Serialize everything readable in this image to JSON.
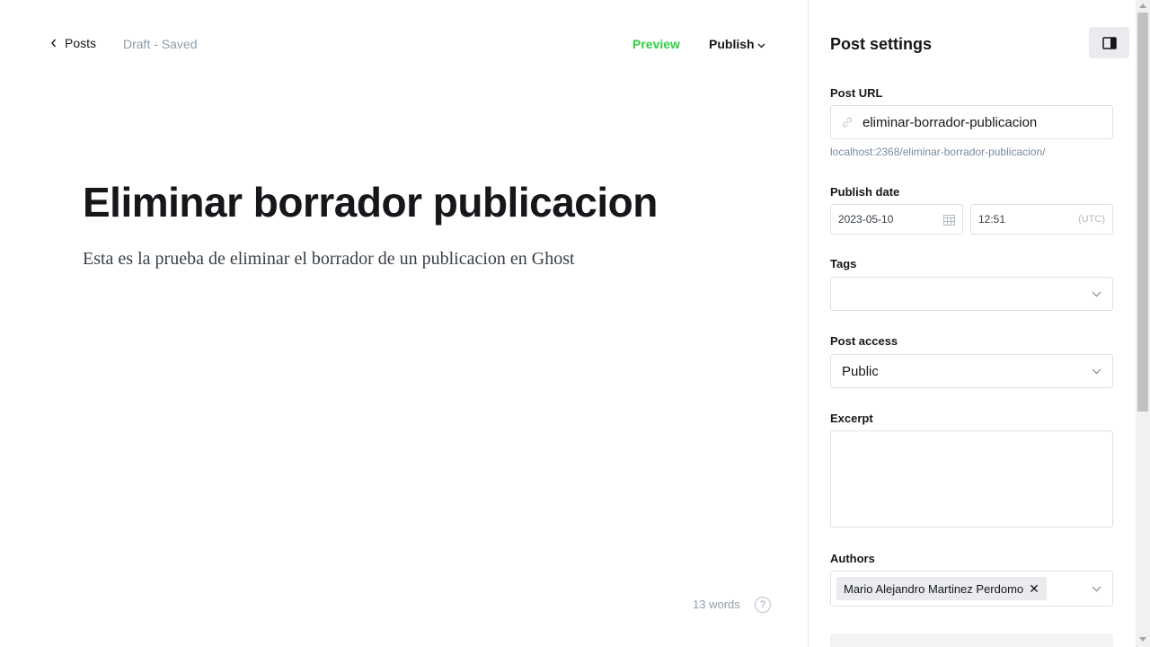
{
  "header": {
    "back_label": "Posts",
    "status": "Draft - Saved",
    "preview_label": "Preview",
    "publish_label": "Publish"
  },
  "post": {
    "title": "Eliminar borrador publicacion",
    "body": "Esta es la prueba de eliminar el borrador de un publicacion en Ghost",
    "word_count": "13 words"
  },
  "settings": {
    "title": "Post settings",
    "url_label": "Post URL",
    "url_value": "eliminar-borrador-publicacion",
    "url_hint": "localhost:2368/eliminar-borrador-publicacion/",
    "publish_date_label": "Publish date",
    "date_value": "2023-05-10",
    "time_value": "12:51",
    "timezone": "(UTC)",
    "tags_label": "Tags",
    "access_label": "Post access",
    "access_value": "Public",
    "excerpt_label": "Excerpt",
    "authors_label": "Authors",
    "author_name": "Mario Alejandro Martinez Perdomo"
  },
  "colors": {
    "accent_green": "#30cf43",
    "text": "#15171a",
    "muted": "#8e9cac"
  },
  "icons": [
    "chevron-left-icon",
    "chevron-down-icon",
    "sidebar-toggle-icon",
    "link-icon",
    "calendar-icon",
    "help-icon",
    "close-icon"
  ]
}
